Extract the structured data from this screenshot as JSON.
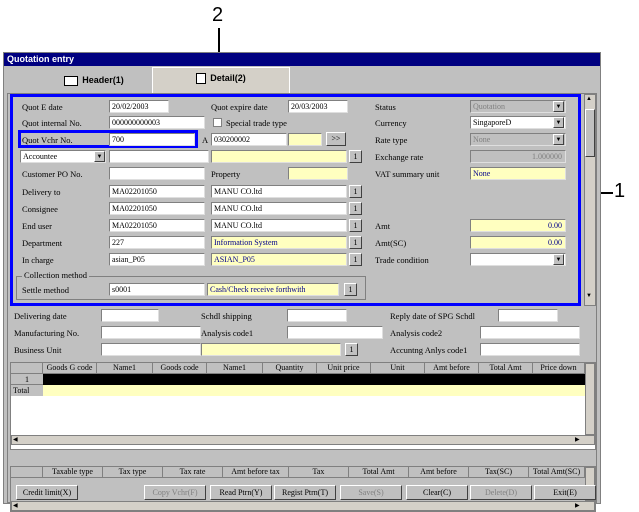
{
  "callouts": {
    "one": "1",
    "two": "2"
  },
  "window": {
    "title": "Quotation entry"
  },
  "tabs": {
    "header": "Header(1)",
    "detail": "Detail(2)"
  },
  "form": {
    "quot_e_date_label": "Quot E date",
    "quot_e_date": "20/02/2003",
    "quot_expire_label": "Quot expire date",
    "quot_expire": "20/03/2003",
    "status_label": "Status",
    "status": "Quotation",
    "internal_no_label": "Quot internal No.",
    "internal_no": "000000000003",
    "special_trade_label": "Special trade type",
    "currency_label": "Currency",
    "currency": "SingaporeD",
    "vchr_no_label": "Quot Vchr No.",
    "vchr_no": "700",
    "a_label": "A",
    "a_value": "030200002",
    "arrow_btn": ">>",
    "rate_type_label": "Rate type",
    "rate_type": "None",
    "accountee_label": "Accountee",
    "exchange_rate_label": "Exchange rate",
    "exchange_rate": "1.000000",
    "customer_po_label": "Customer PO No.",
    "property_label": "Property",
    "vat_summary_label": "VAT summary unit",
    "vat_summary": "None",
    "delivery_to_label": "Delivery to",
    "delivery_to_code": "MA02201050",
    "delivery_to_name": "MANU CO.ltd",
    "consignee_label": "Consignee",
    "consignee_code": "MA02201050",
    "consignee_name": "MANU CO.ltd",
    "end_user_label": "End user",
    "end_user_code": "MA02201050",
    "end_user_name": "MANU CO.ltd",
    "amt_label": "Amt",
    "amt": "0.00",
    "department_label": "Department",
    "department_code": "227",
    "department_name": "Information System",
    "amt_sc_label": "Amt(SC)",
    "amt_sc": "0.00",
    "in_charge_label": "In charge",
    "in_charge_code": "asian_P05",
    "in_charge_name": "ASIAN_P05",
    "trade_condition_label": "Trade condition",
    "collection_method_label": "Collection method",
    "settle_method_label": "Settle method",
    "settle_code": "s0001",
    "settle_name": "Cash/Check receive forthwith",
    "ellipsis_btn": "1",
    "delivering_date_label": "Delivering date",
    "schdl_shipping_label": "Schdl shipping",
    "reply_date_label": "Reply date of SPG Schdl",
    "manufacturing_label": "Manufacturing No.",
    "analysis1_label": "Analysis code1",
    "analysis2_label": "Analysis code2",
    "business_unit_label": "Business Unit",
    "accounting_anlys_label": "Accuntng Anlys code1"
  },
  "goods_grid": {
    "headers": [
      "Goods G code",
      "Name1",
      "Goods code",
      "Name1",
      "Quantity",
      "Unit price",
      "Unit",
      "Amt before",
      "Total Amt",
      "Price down"
    ],
    "row_num": "1",
    "total_label": "Total"
  },
  "tax_grid": {
    "headers": [
      "Taxable type",
      "Tax type",
      "Tax rate",
      "Amt before tax",
      "Tax",
      "Total Amt",
      "Amt before",
      "Tax(SC)",
      "Total Amt(SC)"
    ]
  },
  "buttons": {
    "credit_limit": "Credit limit(X)",
    "copy_vchr": "Copy Vchr(F)",
    "read_ptrn": "Read Ptrn(Y)",
    "regist_ptrn": "Regist Ptrn(T)",
    "save": "Save(S)",
    "clear": "Clear(C)",
    "delete": "Delete(D)",
    "exit": "Exit(E)"
  },
  "colors": {
    "titlebar": "#000080",
    "highlight_frame": "#0000ff",
    "required_field": "#ffffc0"
  }
}
